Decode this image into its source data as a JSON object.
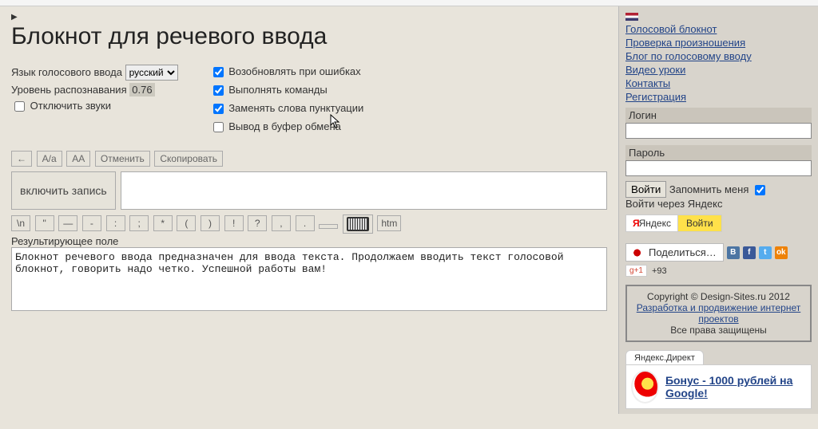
{
  "page": {
    "title": "Блокнот для речевого ввода"
  },
  "settings": {
    "lang_label": "Язык голосового ввода",
    "lang_selected": "русский",
    "recog_label": "Уровень распознавания",
    "recog_value": "0.76",
    "mute_label": "Отключить звуки",
    "mute_checked": false,
    "opts": {
      "resume_errors": {
        "label": "Возобновлять при ошибках",
        "checked": true
      },
      "run_commands": {
        "label": "Выполнять команды",
        "checked": true
      },
      "replace_punct": {
        "label": "Заменять слова пунктуации",
        "checked": true
      },
      "clipboard": {
        "label": "Вывод в буфер обмена",
        "checked": false
      }
    }
  },
  "toolbar": {
    "back": "←",
    "case_toggle": "А/а",
    "case_upper": "АА",
    "undo": "Отменить",
    "copy": "Скопировать"
  },
  "record": {
    "button": "включить запись",
    "input_value": ""
  },
  "symbar": {
    "items": [
      "\\n",
      "\"",
      "—",
      "-",
      ":",
      ";",
      "*",
      "(",
      ")",
      "!",
      "?",
      ",",
      ".",
      ""
    ],
    "htm": "htm"
  },
  "result": {
    "label": "Результирующее поле",
    "text": "Блокнот речевого ввода предназначен для ввода текста. Продолжаем вводить текст голосовой блокнот, говорить надо четко. Успешной работы вам!"
  },
  "sidebar": {
    "nav": [
      "Голосовой блокнот",
      "Проверка произношения",
      "Блог по голосовому вводу",
      "Видео уроки",
      "Контакты",
      "Регистрация"
    ],
    "login_label": "Логин",
    "password_label": "Пароль",
    "login_btn": "Войти",
    "remember_label": "Запомнить меня",
    "remember_checked": true,
    "yandex_via": "Войти через Яндекс",
    "yandex_btn_brand": "Яндекс",
    "yandex_btn_enter": "Войти",
    "share_label": "Поделиться…",
    "gplus": "g+1",
    "gplus_count": "+93",
    "copyright_line1": "Copyright © Design-Sites.ru 2012",
    "copyright_link": "Разработка и продвижение интернет проектов",
    "copyright_line3": "Все права защищены",
    "yadirect_tab": "Яндекс.Директ",
    "ad_title": "Бонус - 1000 рублей на Google!"
  }
}
